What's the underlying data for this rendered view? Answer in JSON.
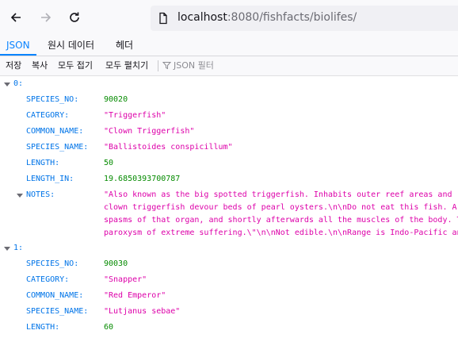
{
  "browser": {
    "url_host": "localhost",
    "url_rest": ":8080/fishfacts/biolifes/"
  },
  "viewer": {
    "tabs": [
      "JSON",
      "원시 데이터",
      "헤더"
    ],
    "toolbar": {
      "save": "저장",
      "copy": "복사",
      "collapse_all": "모두 접기",
      "expand_all": "모두 펼치기",
      "filter_placeholder": "JSON 필터"
    }
  },
  "records": [
    {
      "index": "0:",
      "fields": [
        {
          "key": "SPECIES_NO:",
          "value": "90020"
        },
        {
          "key": "CATEGORY:",
          "value": "\"Triggerfish\""
        },
        {
          "key": "COMMON_NAME:",
          "value": "\"Clown Triggerfish\""
        },
        {
          "key": "SPECIES_NAME:",
          "value": "\"Ballistoides conspicillum\""
        },
        {
          "key": "LENGTH:",
          "value": "50"
        },
        {
          "key": "LENGTH_IN:",
          "value": "19.6850393700787"
        }
      ],
      "notes_key": "NOTES:",
      "notes_lines": [
        "\"Also known as the big spotted triggerfish.  Inhabits outer reef areas and",
        "clown triggerfish devour beds of pearl oysters.\\n\\nDo not eat this fish.  A",
        "spasms of that organ, and shortly afterwards all the muscles of the body.  T",
        "paroxysm of extreme suffering.\\\"\\n\\nNot edible.\\n\\nRange is Indo-Pacific and"
      ]
    },
    {
      "index": "1:",
      "fields": [
        {
          "key": "SPECIES_NO:",
          "value": "90030"
        },
        {
          "key": "CATEGORY:",
          "value": "\"Snapper\""
        },
        {
          "key": "COMMON_NAME:",
          "value": "\"Red Emperor\""
        },
        {
          "key": "SPECIES_NAME:",
          "value": "\"Lutjanus sebae\""
        },
        {
          "key": "LENGTH:",
          "value": "60"
        }
      ]
    }
  ]
}
